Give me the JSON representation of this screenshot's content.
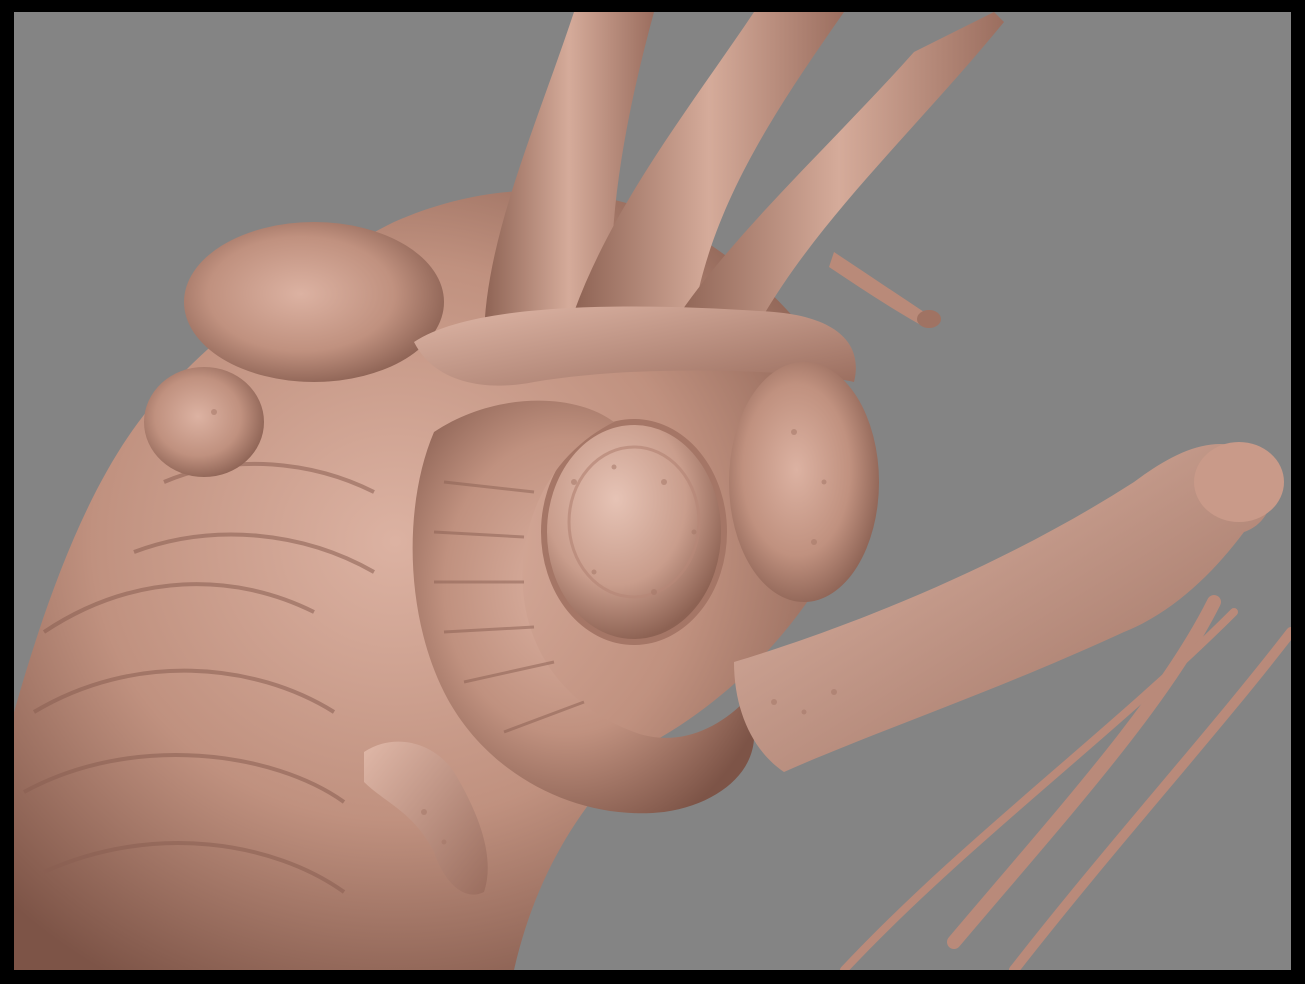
{
  "scene": {
    "subject_icon": "creature-sculpt",
    "background_color": "#848484",
    "border_color": "#000000",
    "clay_color": "#c79a89",
    "clay_shadow": "#8a5f52",
    "clay_highlight": "#e3bcae"
  }
}
